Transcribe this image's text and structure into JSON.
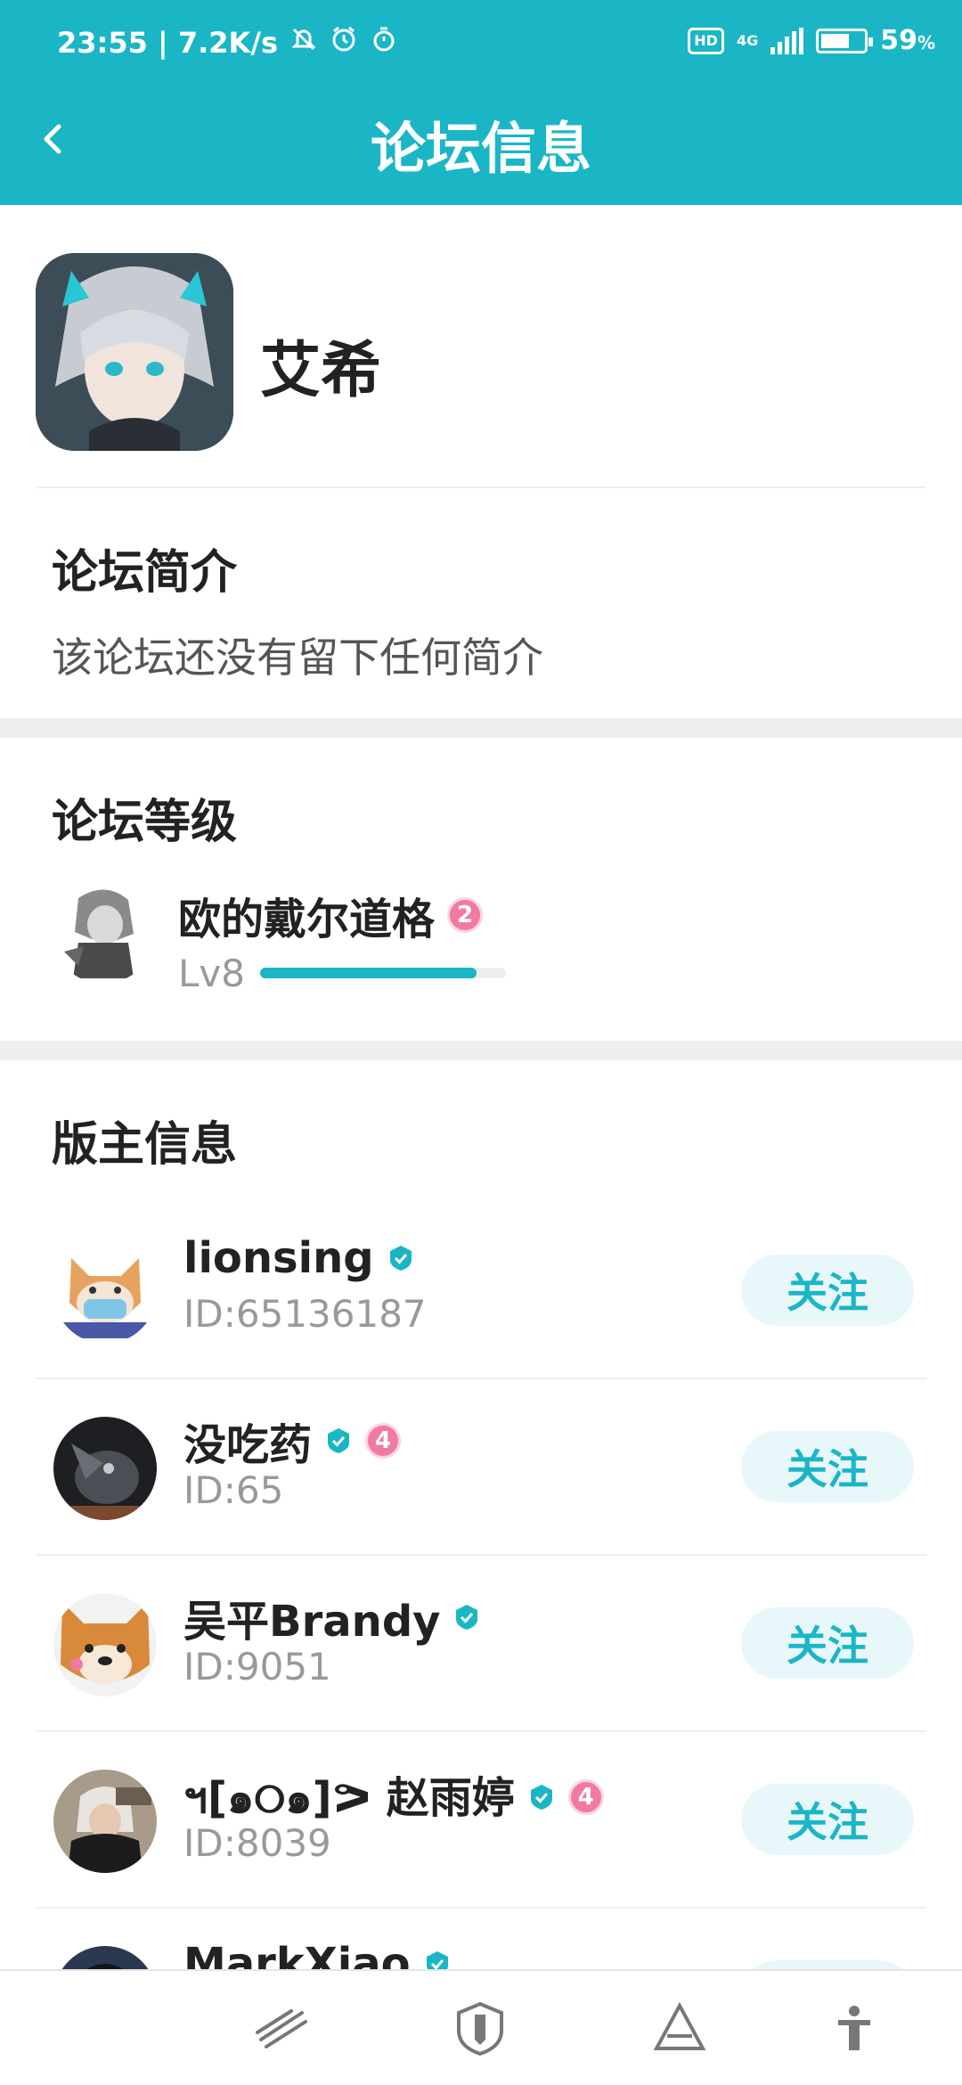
{
  "status_bar": {
    "time_speed": "23:55 | 7.2K/s",
    "hd": "HD",
    "network": "4G",
    "battery": "59",
    "battery_unit": "%"
  },
  "navbar": {
    "title": "论坛信息"
  },
  "forum": {
    "name": "艾希"
  },
  "intro": {
    "title": "论坛简介",
    "text": "该论坛还没有留下任何简介"
  },
  "level": {
    "title": "论坛等级",
    "user_name": "欧的戴尔道格",
    "rank": "2",
    "lv": "Lv8",
    "progress": 0.88
  },
  "moderators": {
    "title": "版主信息",
    "follow_label": "关注",
    "items": [
      {
        "name": "lionsing",
        "id": "ID:65136187",
        "badge": ""
      },
      {
        "name": "没吃药",
        "id": "ID:65",
        "badge": "4"
      },
      {
        "name": "吴平Brandy",
        "id": "ID:9051",
        "badge": ""
      },
      {
        "name": "ฯ[๑୦๑]ᕗ 赵雨婷",
        "id": "ID:8039",
        "badge": "4"
      },
      {
        "name": "MarkXiao",
        "id": "",
        "badge": ""
      }
    ]
  },
  "colors": {
    "accent": "#1bb6c5",
    "follow_bg": "#e8f8fa",
    "badge_pink": "#f07aa2"
  },
  "bottom_nav": {
    "icons": [
      "slash-lines-icon",
      "shield-icon",
      "triangle-icon",
      "person-icon"
    ]
  }
}
